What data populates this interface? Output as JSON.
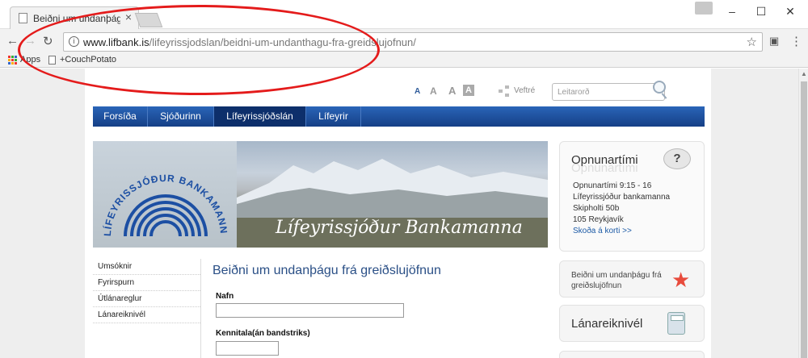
{
  "browser": {
    "tab_title": "Beiðni um undanþágu frá",
    "tab_close": "×",
    "window_controls": {
      "minimize": "–",
      "maximize": "☐",
      "close": "✕"
    },
    "nav": {
      "back": "←",
      "forward": "→",
      "reload": "↻"
    },
    "url_host": "www.lifbank.is",
    "url_path": "/lifeyrissjodslan/beidni-um-undanthagu-fra-greidslujofnun/",
    "info_icon": "i",
    "star": "☆",
    "menu": "⋮",
    "bookmarks": {
      "apps": "Apps",
      "item": "+CouchPotato"
    }
  },
  "site": {
    "font_sizes": [
      "A",
      "A",
      "A",
      "A"
    ],
    "sitemap_label": "Veftré",
    "search_placeholder": "Leitarorð",
    "mainnav": [
      "Forsíða",
      "Sjóðurinn",
      "Lífeyrissjóðslán",
      "Lífeyrir"
    ],
    "banner": {
      "logo_text": "LÍFEYRISSJÓÐUR BANKAMANNA",
      "slogan": "Lífeyrissjóður Bankamanna"
    },
    "sidenav": [
      "Umsóknir",
      "Fyrirspurn",
      "Útlánareglur",
      "Lánareiknivél"
    ],
    "form": {
      "title": "Beiðni um undanþágu frá greiðslujöfnun",
      "name_label": "Nafn",
      "kt_label": "Kennitala(án bandstriks)"
    },
    "hours_box": {
      "title": "Opnunartími",
      "icon": "?",
      "lines": [
        "Opnunartími 9:15 - 16",
        "Lífeyrissjóður bankamanna",
        "Skipholti 50b",
        "105 Reykjavík"
      ],
      "map_link": "Skoða á korti >>"
    },
    "exemption_box": "Beiðni um undanþágu frá greiðslujöfnun",
    "calc_box": "Lánareiknivél"
  },
  "colors": {
    "nav_blue": "#1d4f9e",
    "title_blue": "#2a4f86",
    "annotation_red": "#e41b1b"
  }
}
